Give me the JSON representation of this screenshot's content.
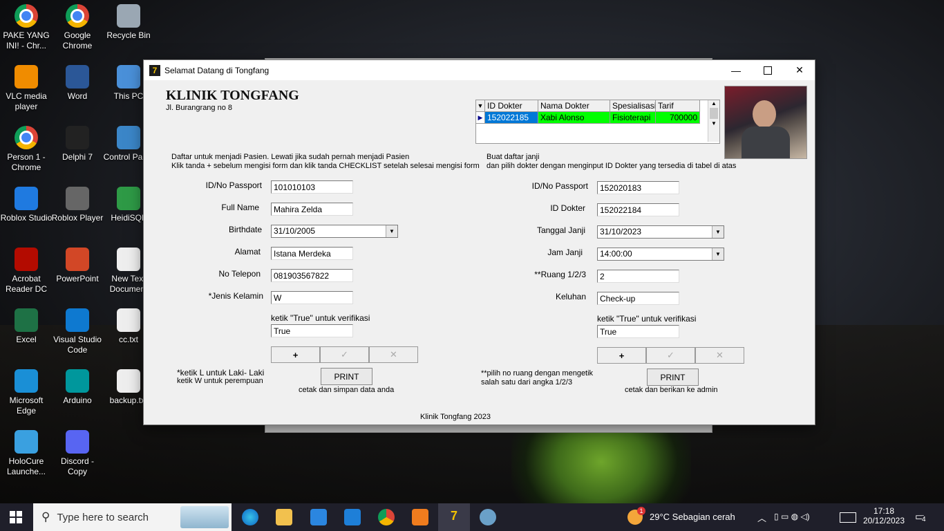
{
  "desktop": {
    "icons": [
      {
        "label": "PAKE YANG INI! - Chr...",
        "icon": "chrome-icon"
      },
      {
        "label": "Google Chrome",
        "icon": "chrome-icon"
      },
      {
        "label": "Recycle Bin",
        "icon": "recycle-bin-icon"
      },
      {
        "label": "VLC media player",
        "icon": "vlc-icon"
      },
      {
        "label": "Word",
        "icon": "word-icon"
      },
      {
        "label": "This PC",
        "icon": "computer-icon"
      },
      {
        "label": "Person 1 - Chrome",
        "icon": "chrome-icon"
      },
      {
        "label": "Delphi 7",
        "icon": "delphi-icon"
      },
      {
        "label": "Control Panel",
        "icon": "control-panel-icon"
      },
      {
        "label": "Roblox Studio",
        "icon": "roblox-studio-icon"
      },
      {
        "label": "Roblox Player",
        "icon": "roblox-icon"
      },
      {
        "label": "HeidiSQL",
        "icon": "heidisql-icon"
      },
      {
        "label": "Acrobat Reader DC",
        "icon": "acrobat-icon"
      },
      {
        "label": "PowerPoint",
        "icon": "powerpoint-icon"
      },
      {
        "label": "New Text Document",
        "icon": "text-file-icon"
      },
      {
        "label": "Excel",
        "icon": "excel-icon"
      },
      {
        "label": "Visual Studio Code",
        "icon": "vscode-icon"
      },
      {
        "label": "cc.txt",
        "icon": "text-file-icon"
      },
      {
        "label": "Microsoft Edge",
        "icon": "edge-icon"
      },
      {
        "label": "Arduino",
        "icon": "arduino-icon"
      },
      {
        "label": "backup.txt",
        "icon": "text-file-icon"
      },
      {
        "label": "HoloCure Launche...",
        "icon": "holocure-icon"
      },
      {
        "label": "Discord - Copy",
        "icon": "discord-icon"
      }
    ]
  },
  "window": {
    "title": "Selamat Datang di Tongfang",
    "clinic_name": "KLINIK TONGFANG",
    "address": "Jl. Burangrang no 8",
    "footer": "Klinik Tongfang 2023"
  },
  "grid": {
    "columns": [
      "ID Dokter",
      "Nama Dokter",
      "Spesialisasi",
      "Tarif"
    ],
    "rows": [
      {
        "id": "152022185",
        "nama": "Xabi Alonso",
        "spesialisasi": "Fisioterapi",
        "tarif": "700000"
      }
    ]
  },
  "left_form": {
    "intro_line1": "Daftar untuk menjadi Pasien. Lewati jika sudah pernah menjadi Pasien",
    "intro_line2": "Klik tanda + sebelum mengisi form dan klik tanda CHECKLIST setelah selesai mengisi form",
    "fields": [
      {
        "label": "ID/No Passport",
        "value": "101010103"
      },
      {
        "label": "Full Name",
        "value": "Mahira Zelda"
      },
      {
        "label": "Birthdate",
        "value": "31/10/2005"
      },
      {
        "label": "Alamat",
        "value": "Istana Merdeka"
      },
      {
        "label": "No Telepon",
        "value": "081903567822"
      },
      {
        "label": "*Jenis Kelamin",
        "value": "W"
      }
    ],
    "verify_label": "ketik \"True\" untuk verifikasi",
    "verify_value": "True",
    "nav_add": "+",
    "nav_post": "✓",
    "nav_cancel": "✕",
    "note_line1": "*ketik L untuk Laki- Laki",
    "note_line2": "ketik W untuk perempuan",
    "print_label": "PRINT",
    "print_caption": "cetak dan simpan data anda"
  },
  "right_form": {
    "intro_line1": "Buat daftar janji",
    "intro_line2": "dan pilih dokter dengan menginput ID Dokter yang tersedia di tabel di atas",
    "fields": [
      {
        "label": "ID/No Passport",
        "value": "152020183"
      },
      {
        "label": "ID Dokter",
        "value": "152022184"
      },
      {
        "label": "Tanggal Janji",
        "value": "31/10/2023"
      },
      {
        "label": "Jam Janji",
        "value": "14:00:00"
      },
      {
        "label": "**Ruang 1/2/3",
        "value": "2"
      },
      {
        "label": "Keluhan",
        "value": "Check-up"
      }
    ],
    "verify_label": "ketik \"True\" untuk verifikasi",
    "verify_value": "True",
    "nav_add": "+",
    "nav_post": "✓",
    "nav_cancel": "✕",
    "note_line1": "**pilih no ruang dengan mengetik",
    "note_line2": "salah satu dari angka 1/2/3",
    "print_label": "PRINT",
    "print_caption": "cetak dan berikan ke admin"
  },
  "taskbar": {
    "search_placeholder": "Type here to search",
    "weather": "29°C  Sebagian cerah",
    "time": "17:18",
    "date": "20/12/2023",
    "notification_count": "4",
    "weather_badge": "1"
  },
  "colors": {
    "selected_row_bg": "#0078d7",
    "highlight_row_bg": "#00ff00",
    "taskbar_bg": "#1f1f2a"
  }
}
